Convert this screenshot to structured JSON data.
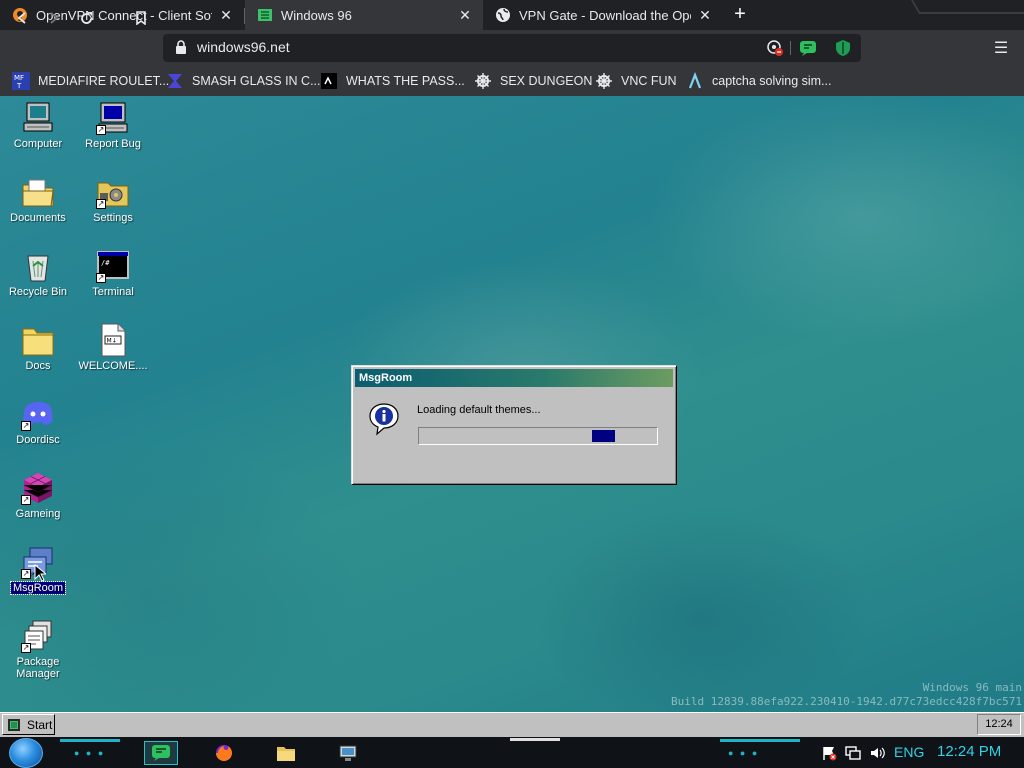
{
  "browser": {
    "tabs": [
      {
        "title": "OpenVPN Connect - Client Software",
        "icon": "openvpn-icon"
      },
      {
        "title": "Windows 96",
        "icon": "windows96-icon"
      },
      {
        "title": "VPN Gate - Download the OpenVPN",
        "icon": "globe-icon"
      }
    ],
    "url": "windows96.net",
    "bookmarks": [
      {
        "label": "MEDIAFIRE ROULET...",
        "icon": "mediafire-icon"
      },
      {
        "label": "SMASH GLASS IN C...",
        "icon": "chevron-bracket-icon"
      },
      {
        "label": "WHATS THE PASS...",
        "icon": "terminal-icon"
      },
      {
        "label": "SEX DUNGEON",
        "icon": "ship-wheel-icon"
      },
      {
        "label": "VNC FUN",
        "icon": "ship-wheel-icon"
      },
      {
        "label": "captcha solving sim...",
        "icon": "lambda-icon"
      }
    ]
  },
  "desktop": {
    "icons": [
      {
        "label": "Computer"
      },
      {
        "label": "Report Bug"
      },
      {
        "label": "Documents"
      },
      {
        "label": "Settings"
      },
      {
        "label": "Recycle Bin"
      },
      {
        "label": "Terminal"
      },
      {
        "label": "Docs"
      },
      {
        "label": "WELCOME...."
      },
      {
        "label": "Doordisc"
      },
      {
        "label": "Gameing"
      },
      {
        "label": "MsgRoom"
      },
      {
        "label": "Package Manager"
      }
    ],
    "build_line1": "Windows 96 main",
    "build_line2": "Build 12839.88efa922.230410-1942.d77c73edcc428f7bc571"
  },
  "dialog": {
    "title": "MsgRoom",
    "message": "Loading default themes...",
    "progress_block_start": 0.73,
    "progress_block_width": 0.1
  },
  "w96_taskbar": {
    "start_label": "Start",
    "clock": "12:24"
  },
  "os_taskbar": {
    "language": "ENG",
    "clock": "12:24 PM"
  },
  "colors": {
    "accent": "#33d1e6",
    "titlebar_start": "#0b5d70",
    "titlebar_end": "#6c9c60",
    "progress": "#000080"
  }
}
